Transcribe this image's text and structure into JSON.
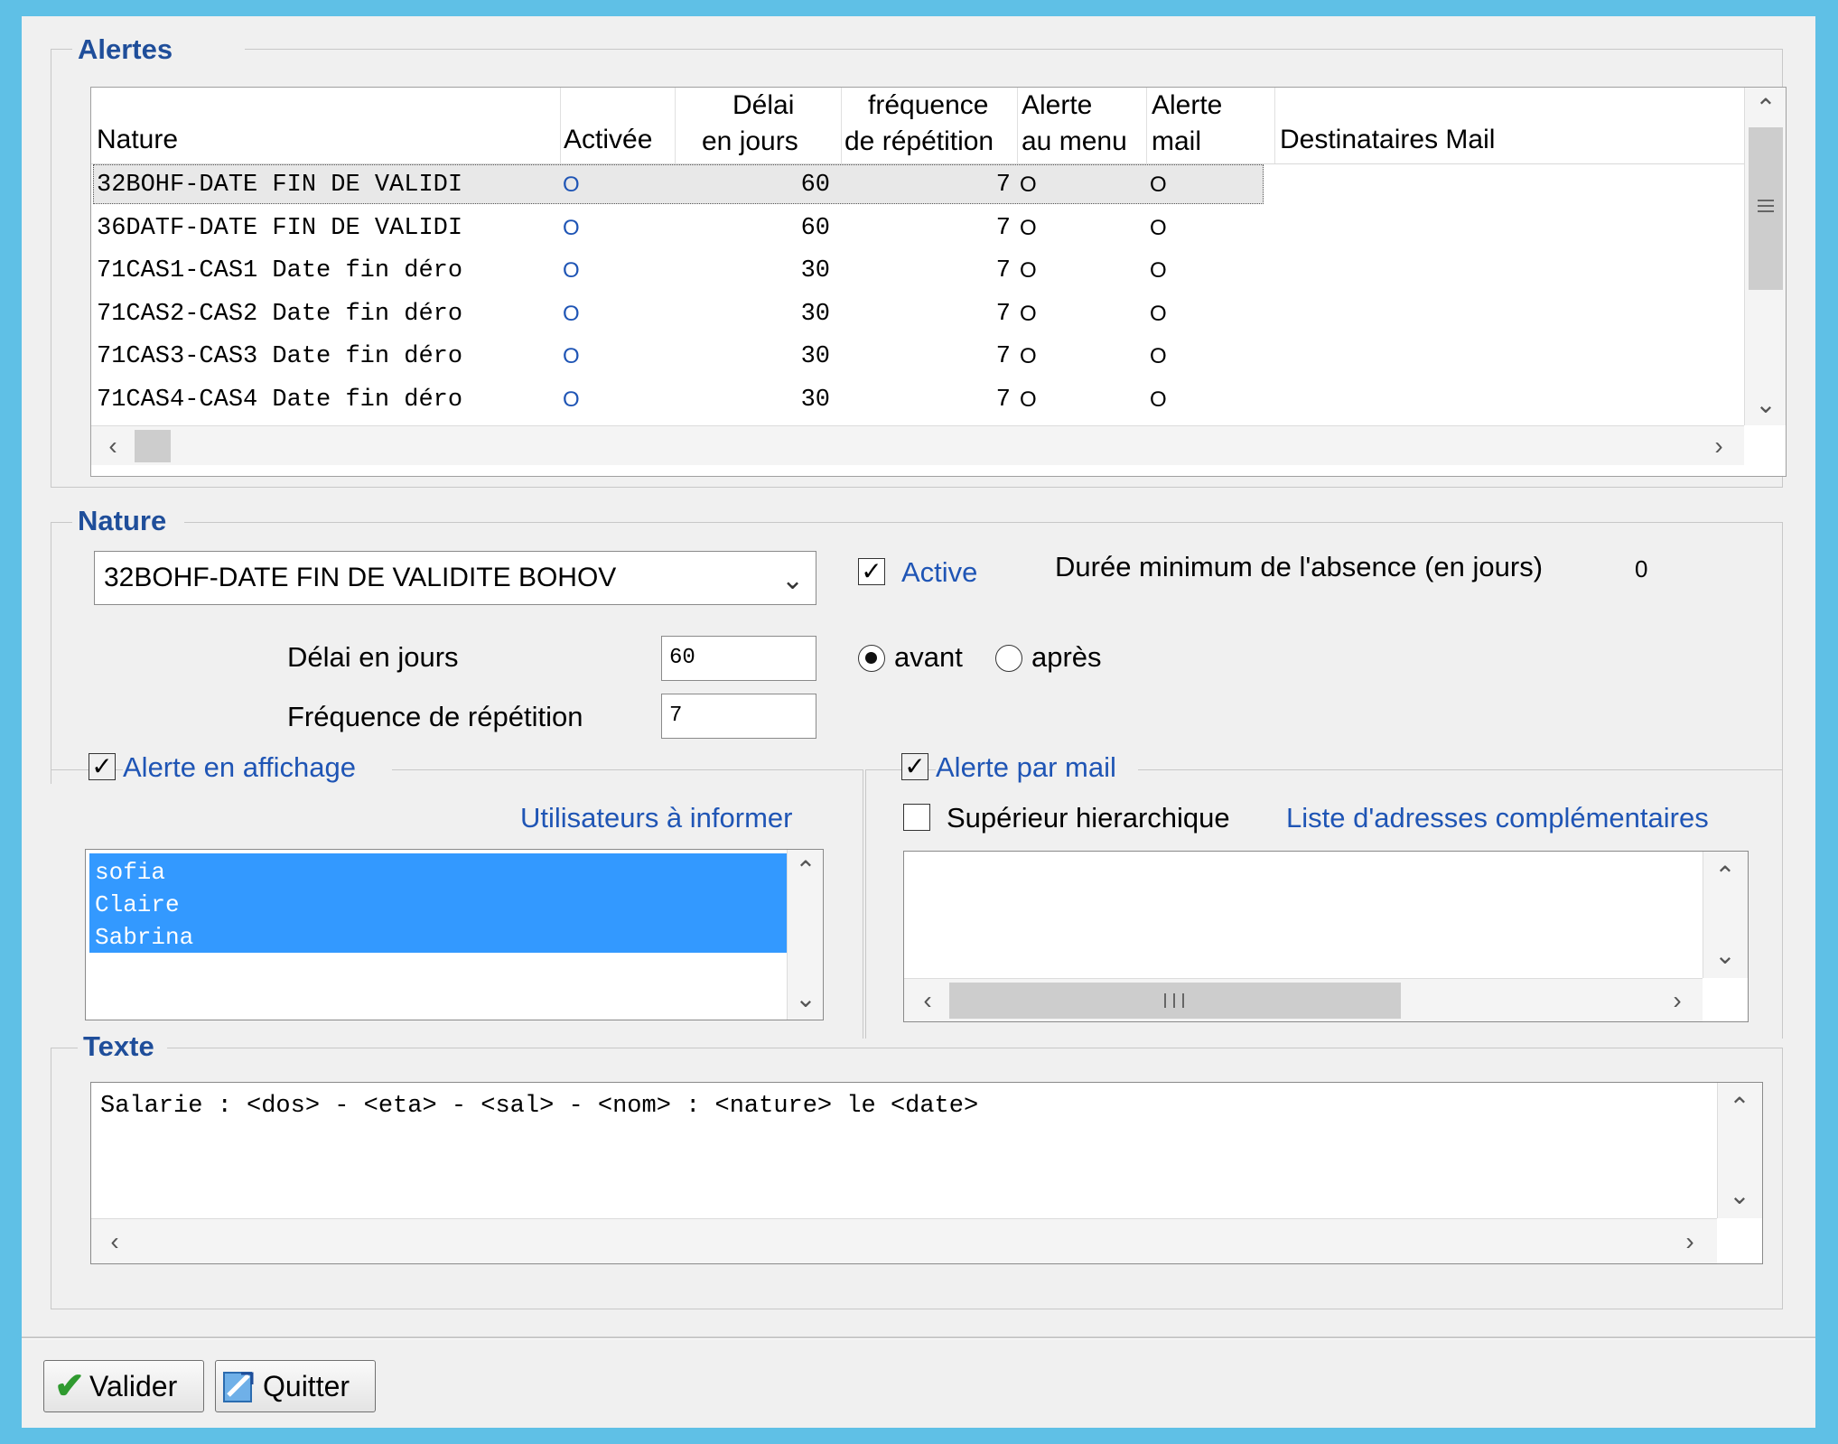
{
  "alertes": {
    "legend": "Alertes",
    "columns": {
      "nature": "Nature",
      "activee": "Activée",
      "delai_l1": "Délai",
      "delai_l2": "en jours",
      "freq_l1": "fréquence",
      "freq_l2": "de répétition",
      "menu_l1": "Alerte",
      "menu_l2": "au menu",
      "mail_l1": "Alerte",
      "mail_l2": "mail",
      "dest": "Destinataires Mail"
    },
    "rows": [
      {
        "nature": "32BOHF-DATE FIN DE VALIDI",
        "activee": "O",
        "delai": "60",
        "freq": "7",
        "menu": "O",
        "mail": "O"
      },
      {
        "nature": "36DATF-DATE FIN DE VALIDI",
        "activee": "O",
        "delai": "60",
        "freq": "7",
        "menu": "O",
        "mail": "O"
      },
      {
        "nature": "71CAS1-CAS1 Date fin déro",
        "activee": "O",
        "delai": "30",
        "freq": "7",
        "menu": "O",
        "mail": "O"
      },
      {
        "nature": "71CAS2-CAS2 Date fin déro",
        "activee": "O",
        "delai": "30",
        "freq": "7",
        "menu": "O",
        "mail": "O"
      },
      {
        "nature": "71CAS3-CAS3 Date fin déro",
        "activee": "O",
        "delai": "30",
        "freq": "7",
        "menu": "O",
        "mail": "O"
      },
      {
        "nature": "71CAS4-CAS4 Date fin déro",
        "activee": "O",
        "delai": "30",
        "freq": "7",
        "menu": "O",
        "mail": "O"
      }
    ]
  },
  "nature": {
    "legend": "Nature",
    "select_value": "32BOHF-DATE FIN DE VALIDITE BOHOV",
    "active_label": "Active",
    "duree_label": "Durée minimum de l'absence (en jours)",
    "duree_value": "0",
    "delai_label": "Délai en jours",
    "delai_value": "60",
    "avant_label": "avant",
    "apres_label": "après",
    "freq_label": "Fréquence de répétition",
    "freq_value": "7"
  },
  "affichage": {
    "label": "Alerte en affichage",
    "users_title": "Utilisateurs à informer",
    "users": [
      "sofia",
      "Claire",
      "Sabrina"
    ]
  },
  "mail": {
    "label": "Alerte par mail",
    "superieur_label": "Supérieur hierarchique",
    "liste_title": "Liste d'adresses complémentaires"
  },
  "texte": {
    "legend": "Texte",
    "content": "Salarie : <dos> - <eta> - <sal> - <nom> : <nature> le <date>"
  },
  "buttons": {
    "valider": "Valider",
    "quitter": "Quitter"
  },
  "colors": {
    "window_border": "#5fc0e6",
    "legend_blue": "#1f4e9a",
    "link_blue": "#1f55b5",
    "selection": "#3399ff"
  }
}
